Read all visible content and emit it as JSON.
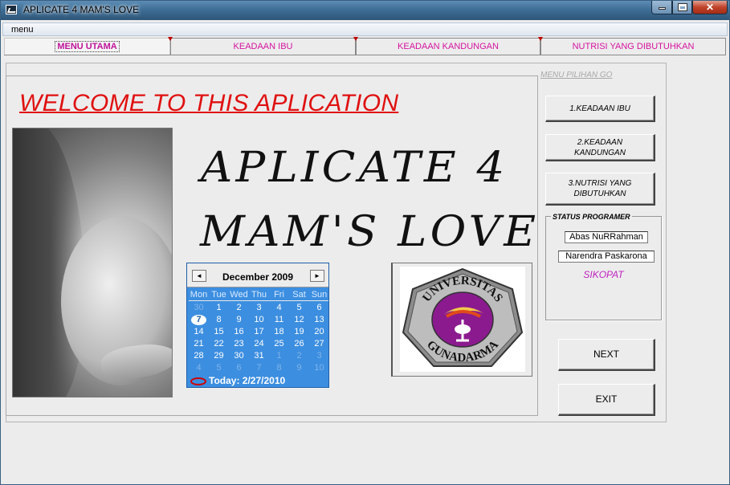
{
  "window": {
    "title": "APLICATE 4 MAM'S LOVE"
  },
  "menubar": {
    "menu_label": "menu"
  },
  "tabs": [
    {
      "label": "MENU UTAMA",
      "active": true
    },
    {
      "label": "KEADAAN IBU",
      "active": false
    },
    {
      "label": "KEADAAN KANDUNGAN",
      "active": false
    },
    {
      "label": "NUTRISI YANG DIBUTUHKAN",
      "active": false
    }
  ],
  "main": {
    "welcome": "WELCOME TO THIS APLICATION",
    "title_line1": "APLICATE 4",
    "title_line2": "MAM'S LOVE"
  },
  "calendar": {
    "month_label": "December 2009",
    "prev": "◄",
    "next": "►",
    "weekdays": [
      "Mon",
      "Tue",
      "Wed",
      "Thu",
      "Fri",
      "Sat",
      "Sun"
    ],
    "weeks": [
      [
        "30",
        "1",
        "2",
        "3",
        "4",
        "5",
        "6"
      ],
      [
        "7",
        "8",
        "9",
        "10",
        "11",
        "12",
        "13"
      ],
      [
        "14",
        "15",
        "16",
        "17",
        "18",
        "19",
        "20"
      ],
      [
        "21",
        "22",
        "23",
        "24",
        "25",
        "26",
        "27"
      ],
      [
        "28",
        "29",
        "30",
        "31",
        "1",
        "2",
        "3"
      ],
      [
        "4",
        "5",
        "6",
        "7",
        "8",
        "9",
        "10"
      ]
    ],
    "selected_day": "7",
    "today_label": "Today: 2/27/2010"
  },
  "logo": {
    "top_text": "UNIVERSITAS",
    "bottom_text": "GUNADARMA"
  },
  "side": {
    "menu_pilihan": "MENU PILIHAN GO",
    "btn_keadaan_ibu": "1.KEADAAN IBU",
    "btn_keadaan_kandungan_l1": "2.KEADAAN",
    "btn_keadaan_kandungan_l2": "KANDUNGAN",
    "btn_nutrisi_l1": "3.NUTRISI YANG",
    "btn_nutrisi_l2": "DIBUTUHKAN",
    "status_legend": "STATUS PROGRAMER",
    "programmer1": "Abas NuRRahman",
    "programmer2": "Narendra Paskarona",
    "group": "SIKOPAT",
    "next": "NEXT",
    "exit": "EXIT"
  },
  "colors": {
    "accent_pink": "#d6139f",
    "welcome_red": "#e01010",
    "calendar_blue": "#3c8ee0"
  }
}
